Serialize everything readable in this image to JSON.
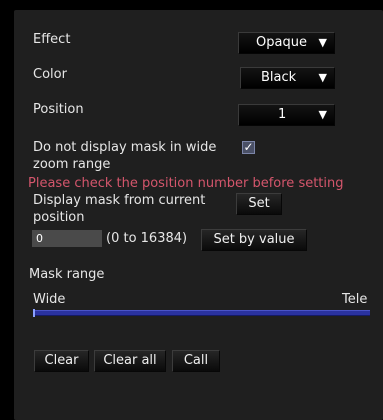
{
  "effect": {
    "label": "Effect",
    "value": "Opaque",
    "arrow": "▼"
  },
  "color": {
    "label": "Color",
    "value": "Black",
    "arrow": "▼"
  },
  "position": {
    "label": "Position",
    "value": "1",
    "arrow": "▼"
  },
  "wide_zoom": {
    "label_line1": "Do not display mask in wide",
    "label_line2": "zoom range",
    "checked": true,
    "check_mark": "✓"
  },
  "warning": "Please check the position number before setting",
  "display_current": {
    "label_line1": "Display mask from current",
    "label_line2": "position",
    "set_label": "Set"
  },
  "value_entry": {
    "value": "0",
    "range_text": "(0 to 16384)",
    "button_label": "Set by value"
  },
  "mask_range": {
    "title": "Mask range",
    "left_label": "Wide",
    "right_label": "Tele",
    "value": 0
  },
  "buttons": {
    "clear": "Clear",
    "clear_all": "Clear all",
    "call": "Call"
  }
}
